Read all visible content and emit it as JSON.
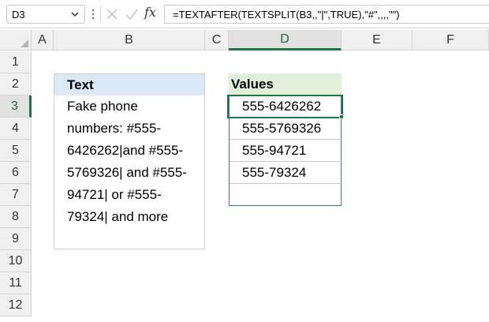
{
  "formula_bar": {
    "name_box": "D3",
    "formula": "=TEXTAFTER(TEXTSPLIT(B3,,\"|\",TRUE),\"#\",,,,\"\")",
    "fx_label": "fx"
  },
  "grid": {
    "columns": [
      "A",
      "B",
      "C",
      "D",
      "E",
      "F"
    ],
    "rows": [
      "1",
      "2",
      "3",
      "4",
      "5",
      "6",
      "7",
      "8",
      "9",
      "10",
      "11",
      "12"
    ],
    "selected_column": "D",
    "selected_row": "3"
  },
  "text_table": {
    "header": "Text",
    "lines": [
      "Fake phone",
      "numbers: #555-",
      "6426262|and #555-",
      "5769326| and #555-",
      "94721| or #555-",
      "79324| and more"
    ]
  },
  "values_table": {
    "header": "Values",
    "values": [
      "555-6426262",
      "555-5769326",
      "555-94721",
      "555-79324",
      ""
    ]
  },
  "colors": {
    "accent": "#217346",
    "text_header_fill": "#dbe9f6",
    "values_header_fill": "#e2efda",
    "values_border": "#3a6fb3"
  }
}
